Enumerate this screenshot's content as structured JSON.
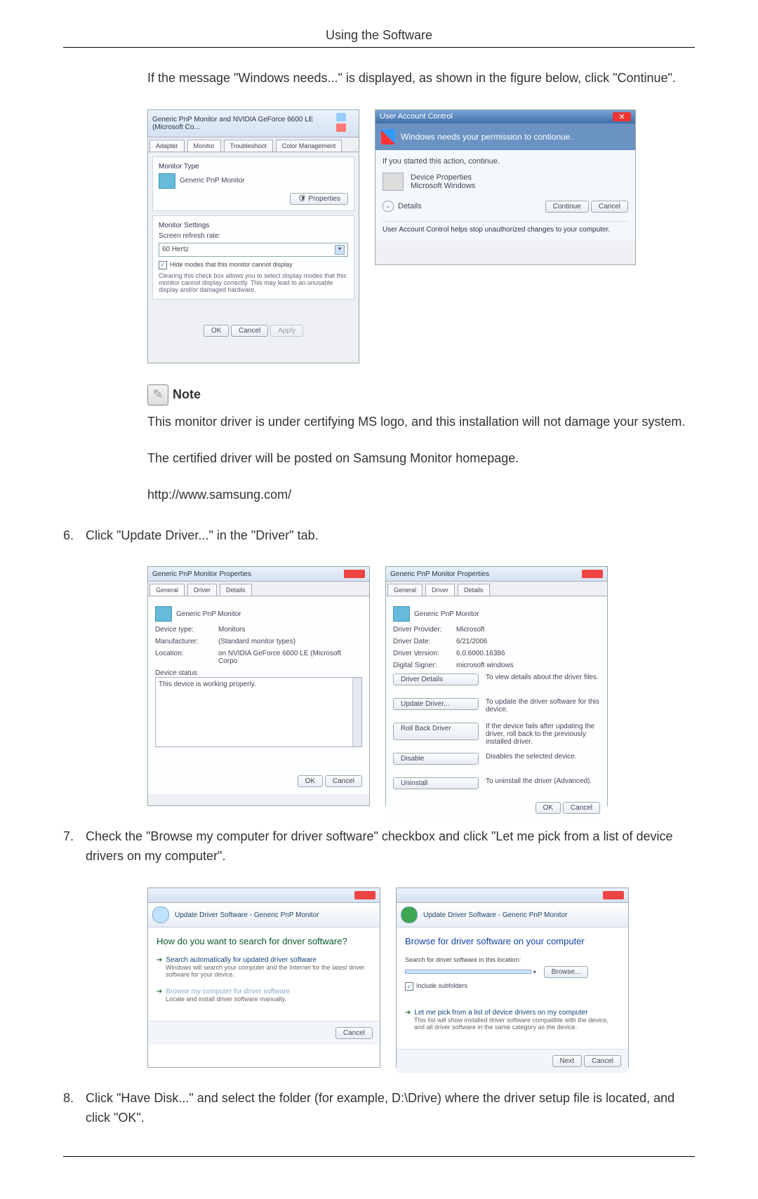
{
  "header": "Using the Software",
  "intro": "If the message \"Windows needs...\" is displayed, as shown in the figure below, click \"Continue\".",
  "fig1a": {
    "title": "Generic PnP Monitor and NVIDIA GeForce 6600 LE (Microsoft Co...",
    "tabs": [
      "Adapter",
      "Monitor",
      "Troubleshoot",
      "Color Management"
    ],
    "monitor_type_hdr": "Monitor Type",
    "monitor_type_val": "Generic PnP Monitor",
    "properties_btn": "Properties",
    "settings_hdr": "Monitor Settings",
    "refresh_lbl": "Screen refresh rate:",
    "refresh_val": "60 Hertz",
    "hide_chk": "Hide modes that this monitor cannot display",
    "hide_desc": "Clearing this check box allows you to select display modes that this monitor cannot display correctly. This may lead to an unusable display and/or damaged hardware.",
    "ok": "OK",
    "cancel": "Cancel",
    "apply": "Apply"
  },
  "fig1b": {
    "title": "User Account Control",
    "band": "Windows needs your permission to contionue.",
    "started": "If you started this action, continue.",
    "dev_prop": "Device Properties",
    "ms_win": "Microsoft Windows",
    "details": "Details",
    "continue": "Continue",
    "cancel": "Cancel",
    "footer": "User Account Control helps stop unauthorized changes to your computer."
  },
  "note": {
    "label": "Note",
    "p1": "This monitor driver is under certifying MS logo, and this installation will not damage your system.",
    "p2": "The certified driver will be posted on Samsung Monitor homepage.",
    "p3": "http://www.samsung.com/"
  },
  "step6": {
    "num": "6.",
    "text": "Click \"Update Driver...\" in the \"Driver\" tab."
  },
  "fig2a": {
    "title": "Generic PnP Monitor Properties",
    "tabs": [
      "General",
      "Driver",
      "Details"
    ],
    "dev": "Generic PnP Monitor",
    "kv": {
      "Device type:": "Monitors",
      "Manufacturer:": "(Standard monitor types)",
      "Location:": "on NVIDIA GeForce 6600 LE (Microsoft Corpo"
    },
    "status_hdr": "Device status",
    "status_txt": "This device is working properly.",
    "ok": "OK",
    "cancel": "Cancel"
  },
  "fig2b": {
    "title": "Generic PnP Monitor Properties",
    "tabs": [
      "General",
      "Driver",
      "Details"
    ],
    "dev": "Generic PnP Monitor",
    "kv": {
      "Driver Provider:": "Microsoft",
      "Driver Date:": "6/21/2006",
      "Driver Version:": "6.0.6000.16386",
      "Digital Signer:": "microsoft windows"
    },
    "btns": [
      {
        "b": "Driver Details",
        "d": "To view details about the driver files."
      },
      {
        "b": "Update Driver...",
        "d": "To update the driver software for this device."
      },
      {
        "b": "Roll Back Driver",
        "d": "If the device fails after updating the driver, roll back to the previously installed driver."
      },
      {
        "b": "Disable",
        "d": "Disables the selected device."
      },
      {
        "b": "Uninstall",
        "d": "To uninstall the driver (Advanced)."
      }
    ],
    "ok": "OK",
    "cancel": "Cancel"
  },
  "step7": {
    "num": "7.",
    "text": "Check the \"Browse my computer for driver software\" checkbox and click \"Let me pick from a list of device drivers on my computer\"."
  },
  "fig3a": {
    "crumb": "Update Driver Software - Generic PnP Monitor",
    "heading": "How do you want to search for driver software?",
    "opt1_t": "Search automatically for updated driver software",
    "opt1_d": "Windows will search your computer and the Internet for the latest driver software for your device.",
    "opt2_t": "Browse my computer for driver software",
    "opt2_d": "Locate and install driver software manually.",
    "cancel": "Cancel"
  },
  "fig3b": {
    "crumb": "Update Driver Software - Generic PnP Monitor",
    "heading": "Browse for driver software on your computer",
    "search_lbl": "Search for driver software in this location:",
    "path": "",
    "browse": "Browse...",
    "include": "Include subfolders",
    "opt_t": "Let me pick from a list of device drivers on my computer",
    "opt_d": "This list will show installed driver software compatible with the device, and all driver software in the same category as the device.",
    "next": "Next",
    "cancel": "Cancel"
  },
  "step8": {
    "num": "8.",
    "text": "Click \"Have Disk...\" and select the folder (for example, D:\\Drive) where the driver setup file is located, and click \"OK\"."
  }
}
